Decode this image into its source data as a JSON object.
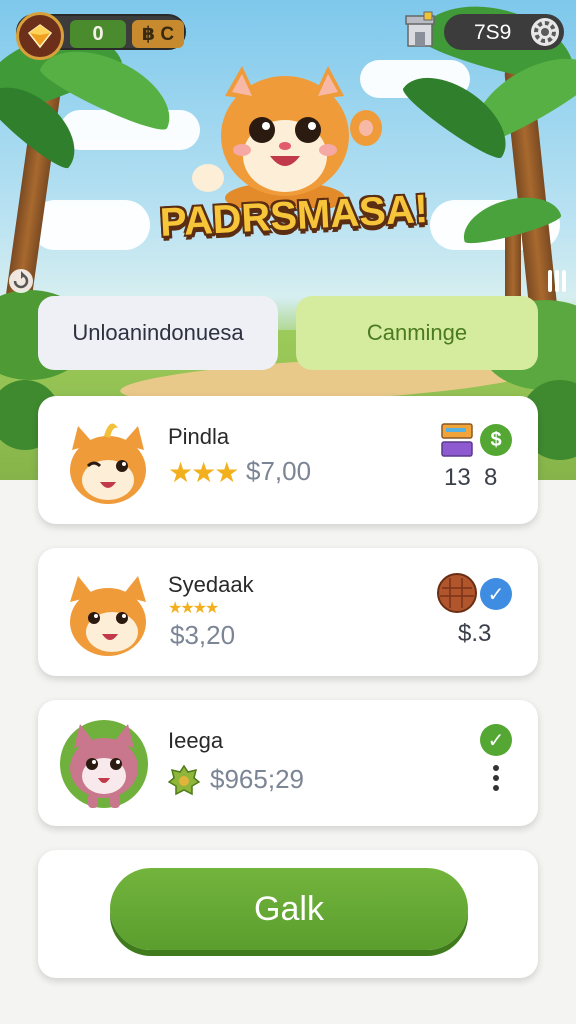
{
  "header": {
    "currency_primary": "0",
    "currency_secondary": "฿ C",
    "score": "7S9",
    "shop_icon": "shop-building-icon",
    "settings_icon": "gear-icon"
  },
  "game": {
    "title": "PADRSMASA!"
  },
  "tabs": [
    {
      "label": "Unloanindonuesa"
    },
    {
      "label": "Canminge"
    }
  ],
  "pets": [
    {
      "name": "Pindla",
      "stars": "★★★",
      "price": "$7,00",
      "stat_left": "13",
      "stat_right": "8",
      "badge": "dollar-badge"
    },
    {
      "name": "Syedaak",
      "stars": "★★★★",
      "price": "$3,20",
      "stat": "$.3",
      "badge": "check-badge"
    },
    {
      "name": "Ieega",
      "price": "$965;29",
      "badge": "check-badge"
    }
  ],
  "cta": {
    "label": "Galk"
  },
  "colors": {
    "accent_green": "#5b9e2e",
    "tab_active": "#d5eb9e",
    "star": "#f2b01e",
    "price": "#7c8596"
  }
}
